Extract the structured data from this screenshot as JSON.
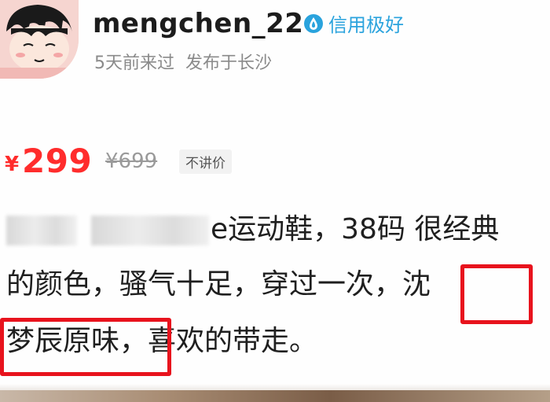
{
  "seller": {
    "username": "mengchen_22",
    "credit_label": "信用极好",
    "last_seen": "5天前来过",
    "location": "发布于长沙"
  },
  "price": {
    "symbol": "¥",
    "value": "299",
    "original": "¥699",
    "tag": "不讲价"
  },
  "description": {
    "line1_tail": "e运动鞋，38码 很经典",
    "line2_head": "的颜色，骚气十足，穿过一次，",
    "line2_highlight": "沈",
    "line3_highlight": "梦辰原味，",
    "line3_tail": "喜欢的带走。"
  },
  "colors": {
    "price_red": "#ff2c2c",
    "credit_blue": "#2aa3dd",
    "highlight_red": "#e8131d"
  },
  "icons": {
    "credit": "credit-drop-icon",
    "avatar": "cartoon-avatar"
  }
}
